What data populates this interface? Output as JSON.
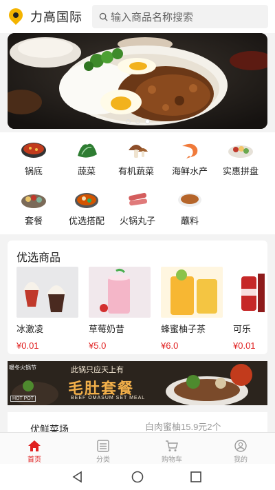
{
  "header": {
    "brand": "力高国际",
    "search_placeholder": "输入商品名称搜索",
    "accent_color": "#f4b400"
  },
  "banner": {
    "slides": 3,
    "active_slide": 3
  },
  "categories": [
    {
      "label": "锅底",
      "icon": "hotpot-base-icon"
    },
    {
      "label": "蔬菜",
      "icon": "vegetable-icon"
    },
    {
      "label": "有机蔬菜",
      "icon": "mushroom-icon"
    },
    {
      "label": "海鲜水产",
      "icon": "shrimp-icon"
    },
    {
      "label": "实惠拼盘",
      "icon": "platter-icon"
    },
    {
      "label": "套餐",
      "icon": "set-meal-icon"
    },
    {
      "label": "优选搭配",
      "icon": "combo-icon"
    },
    {
      "label": "火锅丸子",
      "icon": "meatball-icon"
    },
    {
      "label": "蘸料",
      "icon": "dip-sauce-icon"
    }
  ],
  "featured": {
    "title": "优选商品",
    "products": [
      {
        "name": "冰激凌",
        "price": "¥0.01"
      },
      {
        "name": "草莓奶昔",
        "price": "¥5.0"
      },
      {
        "name": "蜂蜜柚子茶",
        "price": "¥6.0"
      },
      {
        "name": "可乐",
        "price": "¥0.01"
      }
    ]
  },
  "promo": {
    "side_text": "暖冬火锅节",
    "top_text": "此锅只应天上有",
    "title": "毛肚套餐",
    "english": "BEEF OMASUM SET MEAL",
    "hot_pot": "HOT POT"
  },
  "market": {
    "title": "优鲜菜场",
    "note": "白肉蜜柚15.9元2个"
  },
  "tabbar": {
    "items": [
      {
        "label": "首页",
        "icon": "home-icon",
        "active": true
      },
      {
        "label": "分类",
        "icon": "category-icon",
        "active": false
      },
      {
        "label": "购物车",
        "icon": "cart-icon",
        "active": false
      },
      {
        "label": "我的",
        "icon": "profile-icon",
        "active": false
      }
    ],
    "active_color": "#e02020"
  },
  "system_nav": {
    "buttons": [
      "back-icon",
      "home-circle-icon",
      "recents-icon"
    ]
  }
}
